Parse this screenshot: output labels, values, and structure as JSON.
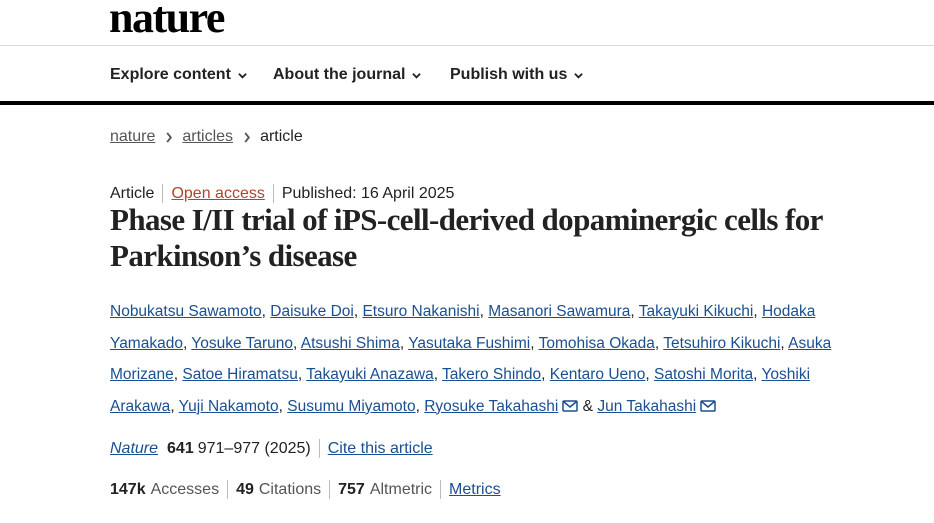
{
  "brand": {
    "logo": "nature"
  },
  "nav": {
    "items": [
      {
        "label": "Explore content"
      },
      {
        "label": "About the journal"
      },
      {
        "label": "Publish with us"
      }
    ]
  },
  "breadcrumb": {
    "items": [
      "nature",
      "articles"
    ],
    "current": "article"
  },
  "article": {
    "type": "Article",
    "access": "Open access",
    "published": "Published: 16 April 2025",
    "title": "Phase I/II trial of iPS-cell-derived dopaminergic cells for Parkinson’s disease",
    "authors": [
      "Nobukatsu Sawamoto",
      "Daisuke Doi",
      "Etsuro Nakanishi",
      "Masanori Sawamura",
      "Takayuki Kikuchi",
      "Hodaka Yamakado",
      "Yosuke Taruno",
      "Atsushi Shima",
      "Yasutaka Fushimi",
      "Tomohisa Okada",
      "Tetsuhiro Kikuchi",
      "Asuka Morizane",
      "Satoe Hiramatsu",
      "Takayuki Anazawa",
      "Takero Shindo",
      "Kentaro Ueno",
      "Satoshi Morita",
      "Yoshiki Arakawa",
      "Yuji Nakamoto",
      "Susumu Miyamoto",
      "Ryosuke Takahashi",
      "Jun Takahashi"
    ],
    "and": "&",
    "journal": "Nature",
    "volume": "641",
    "pages_year": "971–977 (2025)",
    "cite_label": "Cite this article"
  },
  "metrics": {
    "accesses_value": "147k",
    "accesses_label": "Accesses",
    "citations_value": "49",
    "citations_label": "Citations",
    "altmetric_value": "757",
    "altmetric_label": "Altmetric",
    "link_label": "Metrics"
  }
}
